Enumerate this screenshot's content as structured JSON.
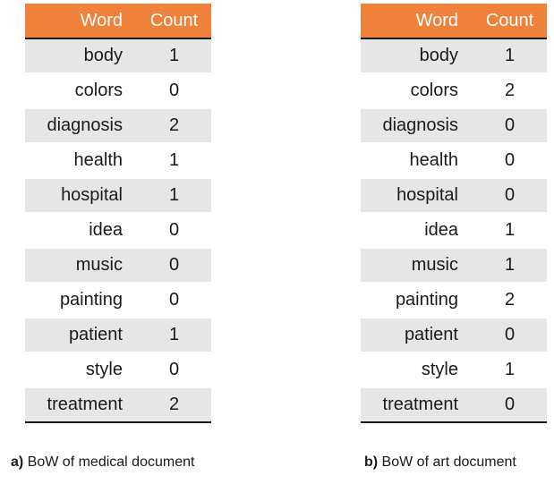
{
  "headers": {
    "word": "Word",
    "count": "Count"
  },
  "tables": [
    {
      "caption_letter": "a)",
      "caption_text": " BoW of medical document",
      "rows": [
        {
          "word": "body",
          "count": "1"
        },
        {
          "word": "colors",
          "count": "0"
        },
        {
          "word": "diagnosis",
          "count": "2"
        },
        {
          "word": "health",
          "count": "1"
        },
        {
          "word": "hospital",
          "count": "1"
        },
        {
          "word": "idea",
          "count": "0"
        },
        {
          "word": "music",
          "count": "0"
        },
        {
          "word": "painting",
          "count": "0"
        },
        {
          "word": "patient",
          "count": "1"
        },
        {
          "word": "style",
          "count": "0"
        },
        {
          "word": "treatment",
          "count": "2"
        }
      ]
    },
    {
      "caption_letter": "b)",
      "caption_text": " BoW of art document",
      "rows": [
        {
          "word": "body",
          "count": "1"
        },
        {
          "word": "colors",
          "count": "2"
        },
        {
          "word": "diagnosis",
          "count": "0"
        },
        {
          "word": "health",
          "count": "0"
        },
        {
          "word": "hospital",
          "count": "0"
        },
        {
          "word": "idea",
          "count": "1"
        },
        {
          "word": "music",
          "count": "1"
        },
        {
          "word": "painting",
          "count": "2"
        },
        {
          "word": "patient",
          "count": "0"
        },
        {
          "word": "style",
          "count": "1"
        },
        {
          "word": "treatment",
          "count": "0"
        }
      ]
    }
  ],
  "colors": {
    "header_fill": "#f0813a",
    "shaded_row": "#e6e6e6"
  }
}
